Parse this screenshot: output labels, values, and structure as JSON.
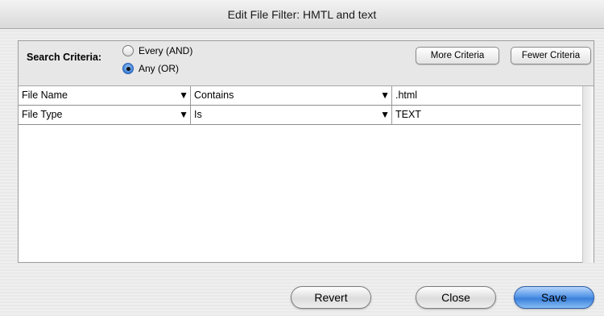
{
  "window": {
    "title": "Edit File Filter: HMTL and text"
  },
  "criteria": {
    "label": "Search Criteria:",
    "options": [
      {
        "label": "Every (AND)",
        "selected": false
      },
      {
        "label": "Any (OR)",
        "selected": true
      }
    ],
    "more_label": "More Criteria",
    "fewer_label": "Fewer Criteria"
  },
  "rows": [
    {
      "field": "File Name",
      "operator": "Contains",
      "value": ".html"
    },
    {
      "field": "File Type",
      "operator": "Is",
      "value": "TEXT"
    }
  ],
  "icons": {
    "dropdown": "triangle-down-icon",
    "radio": "radio-button-icon"
  },
  "buttons": {
    "revert": "Revert",
    "close": "Close",
    "save": "Save"
  },
  "colors": {
    "accent": "#3a7fda"
  }
}
